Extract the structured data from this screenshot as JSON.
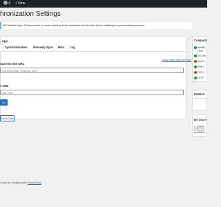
{
  "admin_bar": {
    "comment_count": "0",
    "new_label": "+ New"
  },
  "page": {
    "title": "hronization Settings",
    "notice": "WC Multisite Sync: Please ensure to create a backup of the databases for both sites before initiating the synchronization process."
  },
  "card": {
    "title": "ngs",
    "tabs": [
      "Synchronization",
      "Manually Sync",
      "Misc",
      "Log"
    ],
    "api_key_link": "Setup Manually API Key",
    "current_site_label": "Current Site URL",
    "current_site_placeholder": "s://HomeStore.example.com",
    "target_site_label": "e URL",
    "target_site_placeholder": "Site URL",
    "save_button": "ed",
    "more_button": "More Site"
  },
  "sidebar": {
    "compat_title": "Compatib",
    "checks": [
      {
        "label": "WordP",
        "sub": "(Test",
        "status": "ok"
      },
      {
        "label": "SSL Ve",
        "status": "ok"
      },
      {
        "label": "Site R",
        "status": "bad"
      },
      {
        "label": "PHP (",
        "status": "ok"
      },
      {
        "label": "PHP (",
        "status": "bad"
      },
      {
        "label": "HTTP",
        "status": "ok"
      }
    ],
    "publish_title": "Publish",
    "help_title": "Do you e",
    "help_links": [
      "1. Docum",
      "2. Suppor"
    ]
  },
  "footer": {
    "prefix": "k you for creating with ",
    "link": "WordPress",
    "suffix": "."
  },
  "colors": {
    "accent": "#2271b1",
    "ok": "#00a32a",
    "error": "#d63638",
    "adminbar": "#1d2327"
  }
}
